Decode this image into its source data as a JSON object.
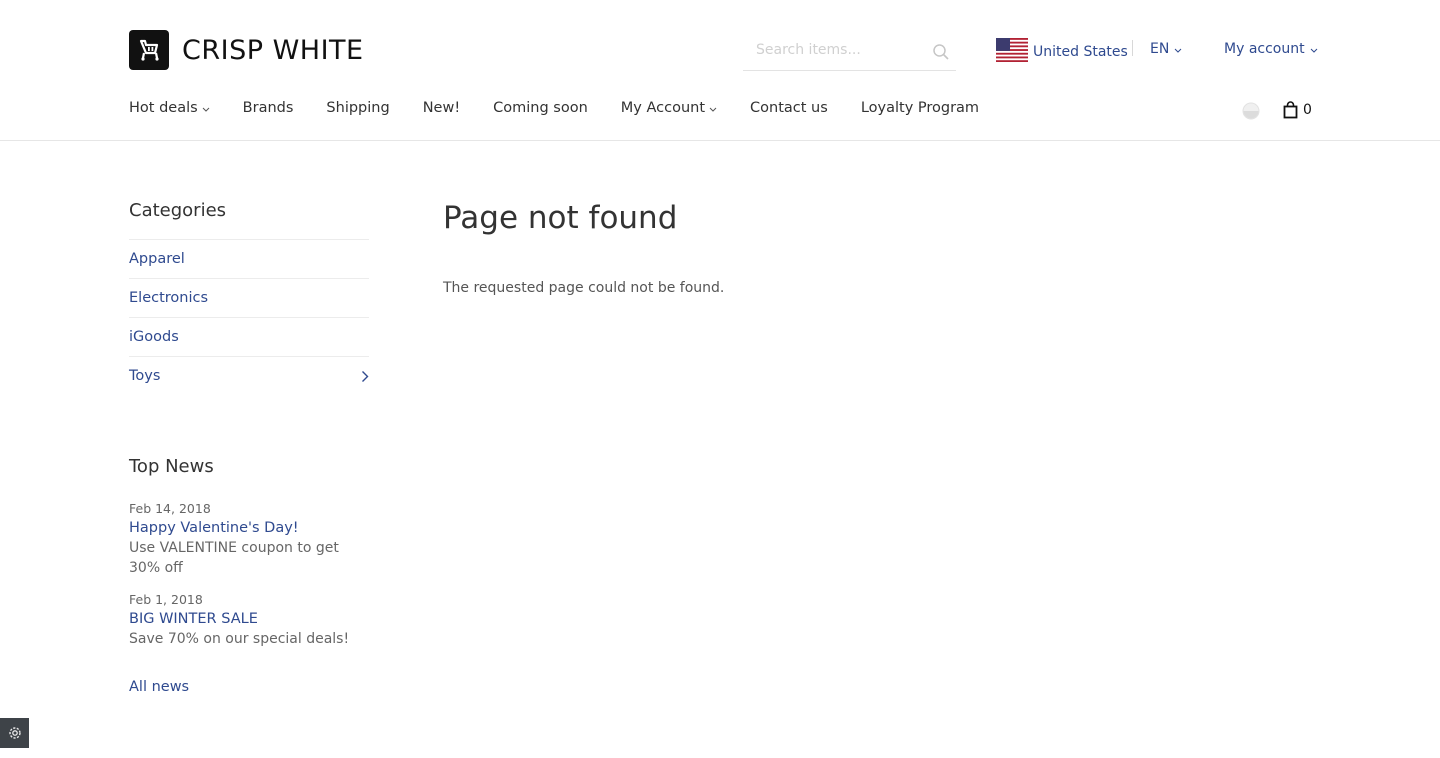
{
  "brand": {
    "name": "CRISP WHITE"
  },
  "search": {
    "placeholder": "Search items..."
  },
  "locale": {
    "country": "United States",
    "language": "EN"
  },
  "account": {
    "label": "My account"
  },
  "nav": {
    "items": [
      {
        "label": "Hot deals",
        "dropdown": true
      },
      {
        "label": "Brands",
        "dropdown": false
      },
      {
        "label": "Shipping",
        "dropdown": false
      },
      {
        "label": "New!",
        "dropdown": false
      },
      {
        "label": "Coming soon",
        "dropdown": false
      },
      {
        "label": "My Account",
        "dropdown": true
      },
      {
        "label": "Contact us",
        "dropdown": false
      },
      {
        "label": "Loyalty Program",
        "dropdown": false
      }
    ]
  },
  "cart": {
    "count": "0"
  },
  "sidebar": {
    "categories_title": "Categories",
    "categories": [
      {
        "label": "Apparel"
      },
      {
        "label": "Electronics"
      },
      {
        "label": "iGoods"
      },
      {
        "label": "Toys"
      }
    ],
    "news_title": "Top News",
    "news": [
      {
        "date": "Feb 14, 2018",
        "title": "Happy Valentine's Day!",
        "body": "Use VALENTINE coupon to get 30% off"
      },
      {
        "date": "Feb 1, 2018",
        "title": "BIG WINTER SALE",
        "body": "Save 70% on our special deals!"
      }
    ],
    "all_news": "All news"
  },
  "main": {
    "title": "Page not found",
    "message": "The requested page could not be found."
  },
  "colors": {
    "link": "#2f4a8f",
    "text": "#333333",
    "muted": "#666666"
  },
  "icons": [
    "logo-cart-icon",
    "search-icon",
    "us-flag-icon",
    "chevron-down-icon",
    "compare-icon",
    "shopping-bag-icon",
    "chevron-right-icon",
    "gear-icon"
  ]
}
